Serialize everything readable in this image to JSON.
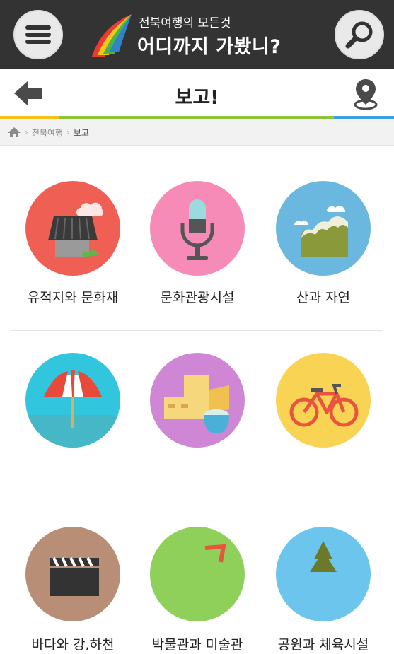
{
  "header": {
    "subtitle": "전북여행의 모든것",
    "title": "어디까지 가봤니?"
  },
  "subheader": {
    "title": "보고!"
  },
  "breadcrumb": {
    "items": [
      "전북여행",
      "보고"
    ]
  },
  "categories": [
    {
      "label": "유적지와 문화재",
      "color": "#f05f54"
    },
    {
      "label": "문화관광시설",
      "color": "#f68bb8"
    },
    {
      "label": "산과 자연",
      "color": "#6ab8e0"
    },
    {
      "label": "바다와 강,하천",
      "color": "#31c6dd"
    },
    {
      "label": "박물관과 미술관",
      "color": "#cf86d4"
    },
    {
      "label": "공원과 체육시설",
      "color": "#f9d454"
    },
    {
      "label": "",
      "color": "#b88e76"
    },
    {
      "label": "",
      "color": "#8fd05a"
    },
    {
      "label": "",
      "color": "#6bc5ec"
    }
  ],
  "colors": {
    "topbar": "#333333",
    "strip": [
      "#f3c21c",
      "#8fc33b",
      "#3d9ee0"
    ]
  },
  "icons": [
    "menu-icon",
    "search-icon",
    "back-arrow-icon",
    "map-pin-icon",
    "home-icon"
  ]
}
